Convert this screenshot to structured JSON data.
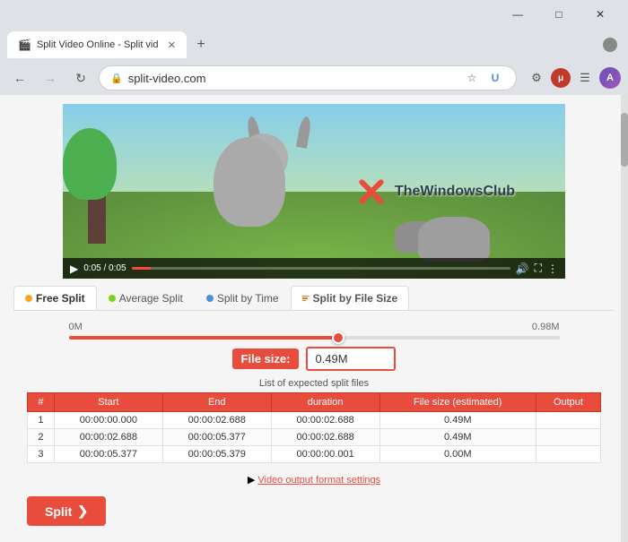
{
  "browser": {
    "title": "Split Video Online - Split video i...",
    "tab_favicon": "🎬",
    "url": "split-video.com",
    "nav": {
      "back_disabled": false,
      "forward_disabled": true,
      "reload_label": "↻"
    },
    "window_controls": {
      "minimize": "—",
      "maximize": "□",
      "close": "✕"
    }
  },
  "video": {
    "time_current": "0:05",
    "time_total": "0:05",
    "progress_percent": 5
  },
  "tabs": [
    {
      "id": "free",
      "label": "Free Split",
      "dot_color": "#f5a623",
      "active": true
    },
    {
      "id": "average",
      "label": "Average Split",
      "dot_color": "#7ed321",
      "active": false
    },
    {
      "id": "time",
      "label": "Split by Time",
      "dot_color": "#4a90d9",
      "active": false
    },
    {
      "id": "filesize",
      "label": "Split by File Size",
      "dot_color": "#e67e22",
      "active": false
    }
  ],
  "slider": {
    "min_label": "0M",
    "max_label": "0.98M",
    "value_percent": 55
  },
  "file_size": {
    "label": "File size:",
    "value": "0.49M"
  },
  "table": {
    "title": "List of expected split files",
    "headers": [
      "#",
      "Start",
      "End",
      "duration",
      "File size (estimated)",
      "Output"
    ],
    "rows": [
      [
        "1",
        "00:00:00.000",
        "00:00:02.688",
        "00:00:02.688",
        "0.49M",
        ""
      ],
      [
        "2",
        "00:00:02.688",
        "00:00:05.377",
        "00:00:02.688",
        "0.49M",
        ""
      ],
      [
        "3",
        "00:00:05.377",
        "00:00:05.379",
        "00:00:00.001",
        "0.00M",
        ""
      ]
    ]
  },
  "video_output_link": "Video output format settings",
  "split_button": {
    "label": "Split",
    "arrow": "❯"
  },
  "watermark": {
    "text": "TheWindowsClub"
  }
}
